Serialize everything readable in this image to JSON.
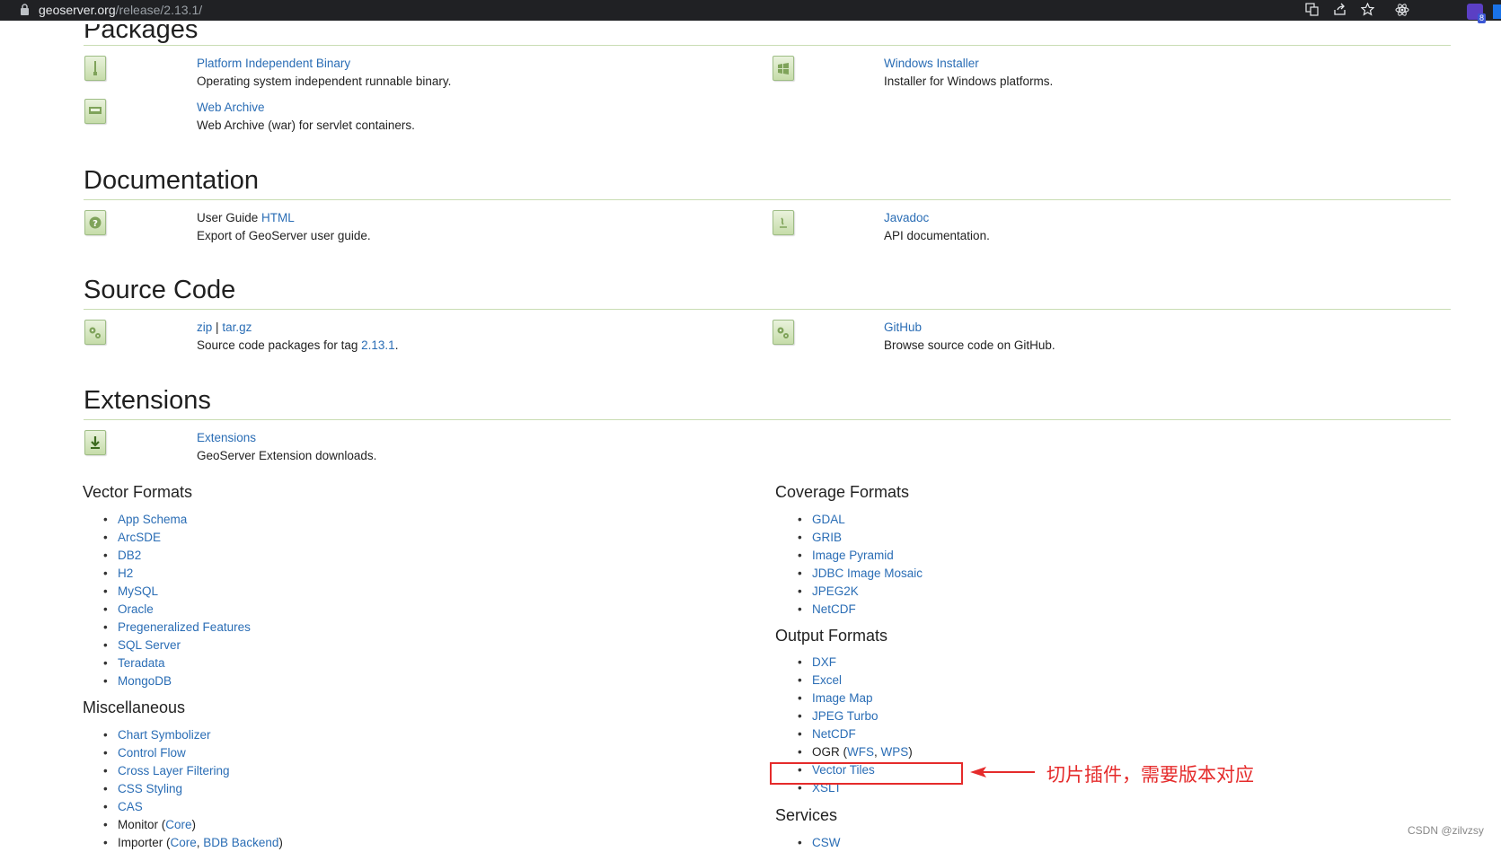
{
  "browser": {
    "url_host": "geoserver.org",
    "url_path": "/release/2.13.1/",
    "extension_count": "8"
  },
  "packages": {
    "title": "Packages",
    "items": [
      {
        "link": "Platform Independent Binary",
        "desc": "Operating system independent runnable binary."
      },
      {
        "link": "Windows Installer",
        "desc": "Installer for Windows platforms."
      },
      {
        "link": "Web Archive",
        "desc": "Web Archive (war) for servlet containers."
      }
    ]
  },
  "documentation": {
    "title": "Documentation",
    "user_guide_prefix": "User Guide",
    "user_guide_link": "HTML",
    "user_guide_desc": "Export of GeoServer user guide.",
    "javadoc_link": "Javadoc",
    "javadoc_desc": "API documentation."
  },
  "source_code": {
    "title": "Source Code",
    "zip": "zip",
    "sep": "|",
    "targz": "tar.gz",
    "desc_prefix": "Source code packages for tag",
    "tag": "2.13.1",
    "desc_suffix": ".",
    "github_link": "GitHub",
    "github_desc": "Browse source code on GitHub."
  },
  "extensions": {
    "title": "Extensions",
    "link": "Extensions",
    "desc": "GeoServer Extension downloads.",
    "vector_formats": {
      "title": "Vector Formats",
      "items": [
        "App Schema",
        "ArcSDE",
        "DB2",
        "H2",
        "MySQL",
        "Oracle",
        "Pregeneralized Features",
        "SQL Server",
        "Teradata",
        "MongoDB"
      ]
    },
    "miscellaneous": {
      "title": "Miscellaneous",
      "items": [
        "Chart Symbolizer",
        "Control Flow",
        "Cross Layer Filtering",
        "CSS Styling",
        "CAS"
      ],
      "monitor_prefix": "Monitor (",
      "monitor_link": "Core",
      "monitor_suffix": ")",
      "importer_prefix": "Importer (",
      "importer_link1": "Core",
      "importer_sep": ", ",
      "importer_link2": "BDB Backend",
      "importer_suffix": ")"
    },
    "coverage_formats": {
      "title": "Coverage Formats",
      "items": [
        "GDAL",
        "GRIB",
        "Image Pyramid",
        "JDBC Image Mosaic",
        "JPEG2K",
        "NetCDF"
      ]
    },
    "output_formats": {
      "title": "Output Formats",
      "items": [
        "DXF",
        "Excel",
        "Image Map",
        "JPEG Turbo",
        "NetCDF"
      ],
      "ogr_prefix": "OGR (",
      "ogr_link1": "WFS",
      "ogr_sep": ", ",
      "ogr_link2": "WPS",
      "ogr_suffix": ")",
      "vector_tiles": "Vector Tiles",
      "xslt": "XSLT"
    },
    "services": {
      "title": "Services",
      "items": [
        "CSW"
      ]
    }
  },
  "annotation": {
    "text": "切片插件，需要版本对应",
    "color": "#e52b2b"
  },
  "watermark": "CSDN @zilvzsy",
  "colors": {
    "link": "#2a6db5",
    "rule": "#c9ddb3",
    "topbar": "#202124"
  }
}
